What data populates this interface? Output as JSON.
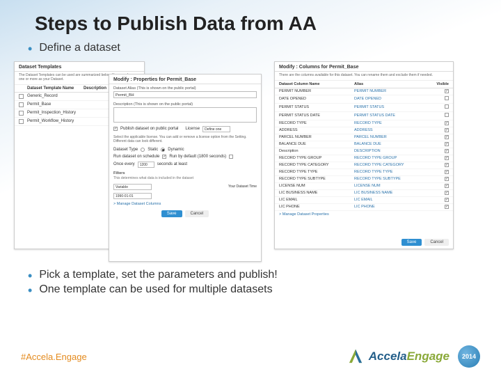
{
  "title": "Steps to Publish Data from AA",
  "bullets": {
    "b1": "Define a dataset",
    "b2": "Pick a template, set the parameters and publish!",
    "b3": "One template can be used for multiple datasets"
  },
  "hashtag": "#Accela.Engage",
  "logo": {
    "a": "Accela",
    "b": "Engage",
    "year": "2014"
  },
  "panelLeft": {
    "head": "Dataset Templates",
    "sub": "The Dataset Templates can be used are summarized below. You can choose one or more as your Dataset.",
    "thead": {
      "name": "Dataset Template Name",
      "desc": "Description"
    },
    "rows": [
      {
        "name": "Generic_Record"
      },
      {
        "name": "Permit_Base"
      },
      {
        "name": "Permit_Inspection_History"
      },
      {
        "name": "Permit_Workflow_History"
      }
    ]
  },
  "panelMid": {
    "head": "Modify : Properties for Permit_Base",
    "alias_label": "Dataset Alias (This is shown on the public portal)",
    "alias_value": "Permit_BH",
    "desc_label": "Description (This is shown on the public portal)",
    "publish_label": "Publish dataset on public portal",
    "license_label": "License",
    "license_value": "Define one",
    "license_note": "Select the applicable license. You can add or remove a license option from the Setting. Different data can look different.",
    "type_label": "Dataset Type",
    "type_static": "Static",
    "type_dynamic": "Dynamic",
    "schedule_label": "Run dataset on schedule",
    "run_default": "Run by default (1800 seconds)",
    "once_every": "Once every",
    "once_value": "1200",
    "once_unit": "seconds at least",
    "filters_label": "Filters",
    "filters_note": "This determines what data is included in the dataset",
    "filter_field": "Variable",
    "filter_val_label": "Your Dataset Time",
    "filter_val": "1990-01-01",
    "link": "> Manage Dataset Columns",
    "save": "Save",
    "cancel": "Cancel"
  },
  "panelRight": {
    "head": "Modify : Columns for Permit_Base",
    "sub": "There are the columns available for this dataset. You can rename them and exclude them if needed.",
    "th": {
      "a": "Dataset Column Name",
      "b": "Alias",
      "c": "Visible"
    },
    "rows": [
      {
        "a": "PERMIT NUMBER",
        "b": "PERMIT NUMBER",
        "on": true
      },
      {
        "a": "DATE OPENED",
        "b": "DATE OPENED",
        "on": false
      },
      {
        "a": "PERMIT STATUS",
        "b": "PERMIT STATUS",
        "on": false
      },
      {
        "a": "PERMIT STATUS DATE",
        "b": "PERMIT STATUS DATE",
        "on": false
      },
      {
        "a": "RECORD TYPE",
        "b": "RECORD TYPE",
        "on": true
      },
      {
        "a": "ADDRESS",
        "b": "ADDRESS",
        "on": true
      },
      {
        "a": "PARCEL NUMBER",
        "b": "PARCEL NUMBER",
        "on": true
      },
      {
        "a": "BALANCE DUE",
        "b": "BALANCE DUE",
        "on": true
      },
      {
        "a": "Description",
        "b": "DESCRIPTION",
        "on": true
      },
      {
        "a": "RECORD TYPE GROUP",
        "b": "RECORD TYPE GROUP",
        "on": true
      },
      {
        "a": "RECORD TYPE CATEGORY",
        "b": "RECORD TYPE CATEGORY",
        "on": true
      },
      {
        "a": "RECORD TYPE TYPE",
        "b": "RECORD TYPE TYPE",
        "on": true
      },
      {
        "a": "RECORD TYPE SUBTYPE",
        "b": "RECORD TYPE SUBTYPE",
        "on": true
      },
      {
        "a": "LICENSE NUM",
        "b": "LICENSE NUM",
        "on": true
      },
      {
        "a": "LIC BUSINESS NAME",
        "b": "LIC BUSINESS NAME",
        "on": true
      },
      {
        "a": "LIC EMAIL",
        "b": "LIC EMAIL",
        "on": true
      },
      {
        "a": "LIC PHONE",
        "b": "LIC PHONE",
        "on": true
      }
    ],
    "link": "> Manage Dataset Properties",
    "save": "Save",
    "cancel": "Cancel"
  }
}
